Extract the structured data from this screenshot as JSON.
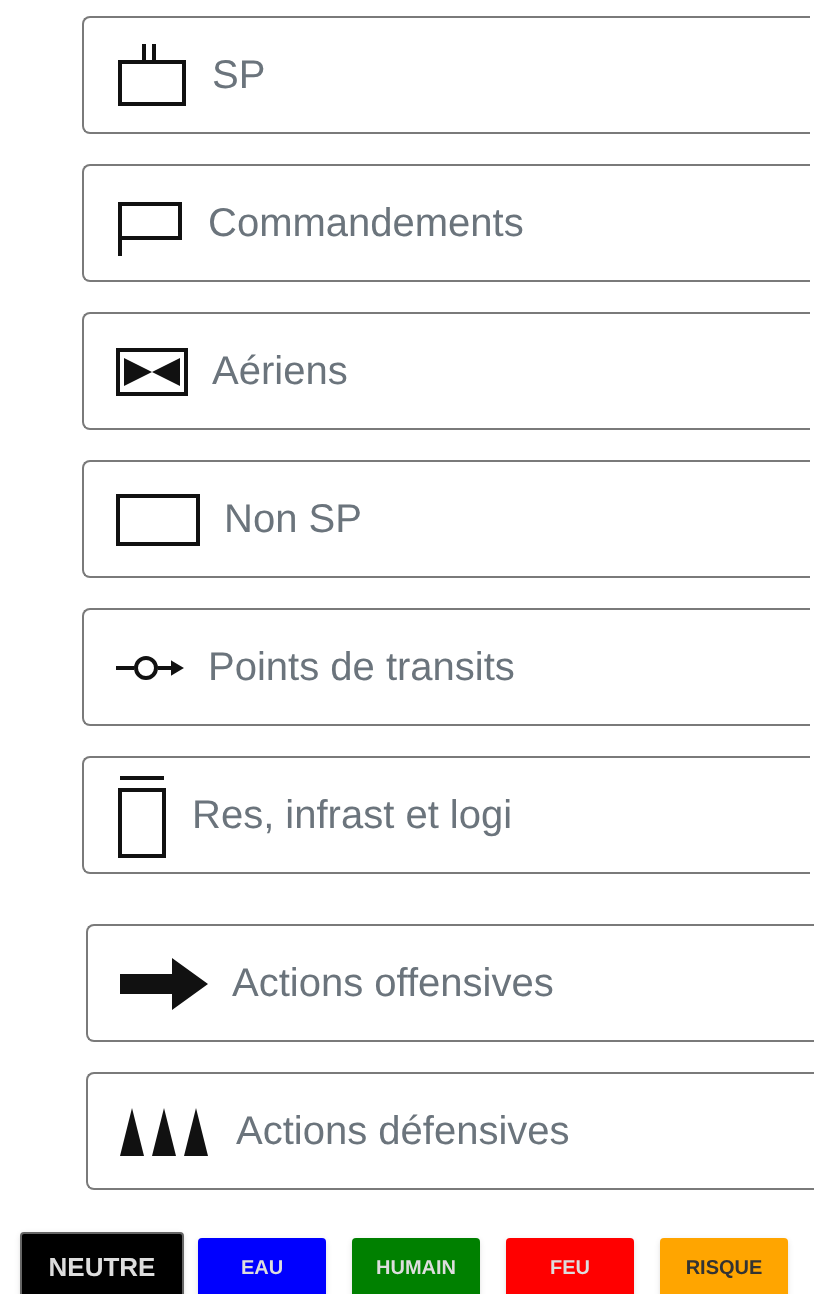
{
  "categories": [
    {
      "kind": "sp",
      "label": "SP"
    },
    {
      "kind": "command",
      "label": "Commandements"
    },
    {
      "kind": "air",
      "label": "Aériens"
    },
    {
      "kind": "non_sp",
      "label": "Non SP"
    },
    {
      "kind": "transit",
      "label": "Points de transits"
    },
    {
      "kind": "res",
      "label": "Res, infrast et logi"
    },
    {
      "kind": "offensive",
      "label": "Actions offensives"
    },
    {
      "kind": "defensive",
      "label": "Actions défensives"
    }
  ],
  "themes": [
    {
      "label": "NEUTRE",
      "color": "#000000",
      "selected": true
    },
    {
      "label": "EAU",
      "color": "#0000ff",
      "selected": false
    },
    {
      "label": "HUMAIN",
      "color": "#008000",
      "selected": false
    },
    {
      "label": "FEU",
      "color": "#ff0000",
      "selected": false
    },
    {
      "label": "RISQUE",
      "color": "#ffa500",
      "selected": false
    }
  ]
}
